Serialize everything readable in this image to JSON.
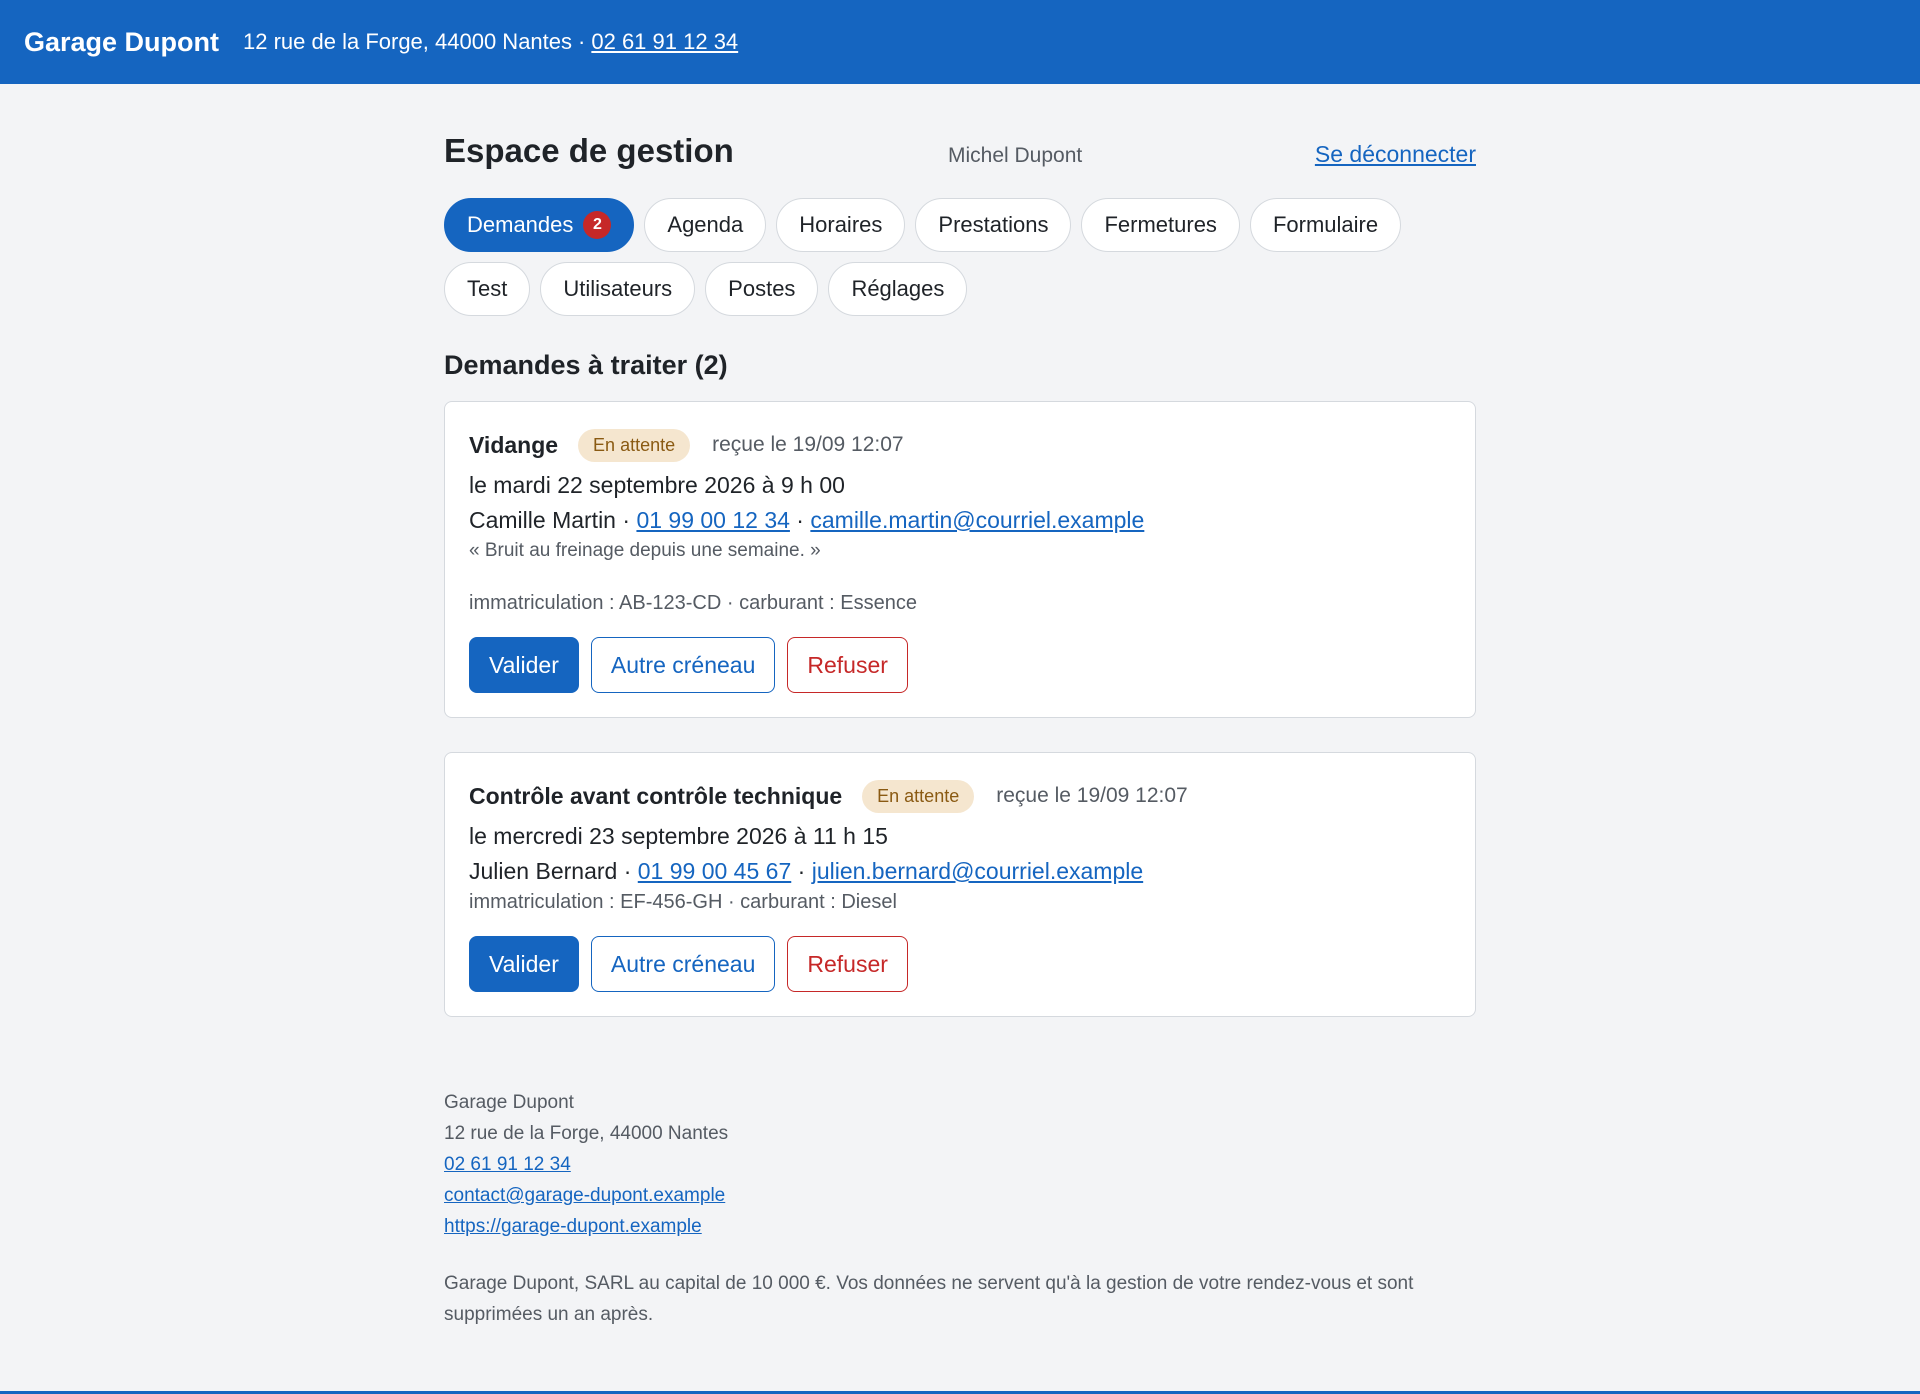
{
  "header": {
    "brand": "Garage Dupont",
    "address": "12 rue de la Forge, 44000 Nantes",
    "separator": "·",
    "phone": "02 61 91 12 34"
  },
  "page": {
    "title": "Espace de gestion",
    "user": "Michel Dupont",
    "logout": "Se déconnecter"
  },
  "tabs": [
    {
      "label": "Demandes",
      "badge": "2",
      "active": true
    },
    {
      "label": "Agenda"
    },
    {
      "label": "Horaires"
    },
    {
      "label": "Prestations"
    },
    {
      "label": "Fermetures"
    },
    {
      "label": "Formulaire"
    },
    {
      "label": "Test"
    },
    {
      "label": "Utilisateurs"
    },
    {
      "label": "Postes"
    },
    {
      "label": "Réglages"
    }
  ],
  "requests": {
    "title": "Demandes à traiter (2)",
    "items": [
      {
        "service": "Vidange",
        "status": "En attente",
        "received": "reçue le 19/09 12:07",
        "slot": "le mardi 22 septembre 2026 à 9 h 00",
        "name": "Camille Martin",
        "sep": " · ",
        "phone": "01 99 00 12 34",
        "email": "camille.martin@courriel.example",
        "note": "« Bruit au freinage depuis une semaine. »",
        "meta": "immatriculation : AB-123-CD · carburant : Essence"
      },
      {
        "service": "Contrôle avant contrôle technique",
        "status": "En attente",
        "received": "reçue le 19/09 12:07",
        "slot": "le mercredi 23 septembre 2026 à 11 h 15",
        "name": "Julien Bernard",
        "sep": " · ",
        "phone": "01 99 00 45 67",
        "email": "julien.bernard@courriel.example",
        "meta": "immatriculation : EF-456-GH · carburant : Diesel"
      }
    ],
    "actions": {
      "validate": "Valider",
      "reschedule": "Autre créneau",
      "refuse": "Refuser"
    }
  },
  "footer": {
    "name": "Garage Dupont",
    "address": "12 rue de la Forge, 44000 Nantes",
    "phone": "02 61 91 12 34",
    "email": "contact@garage-dupont.example",
    "website": "https://garage-dupont.example",
    "legal": "Garage Dupont, SARL au capital de 10 000 €. Vos données ne servent qu'à la gestion de votre rendez-vous et sont supprimées un an après."
  },
  "colors": {
    "brand": "#1565c0",
    "danger": "#c62828",
    "pending_bg": "#f5e6cf",
    "pending_text": "#8a5a12"
  }
}
